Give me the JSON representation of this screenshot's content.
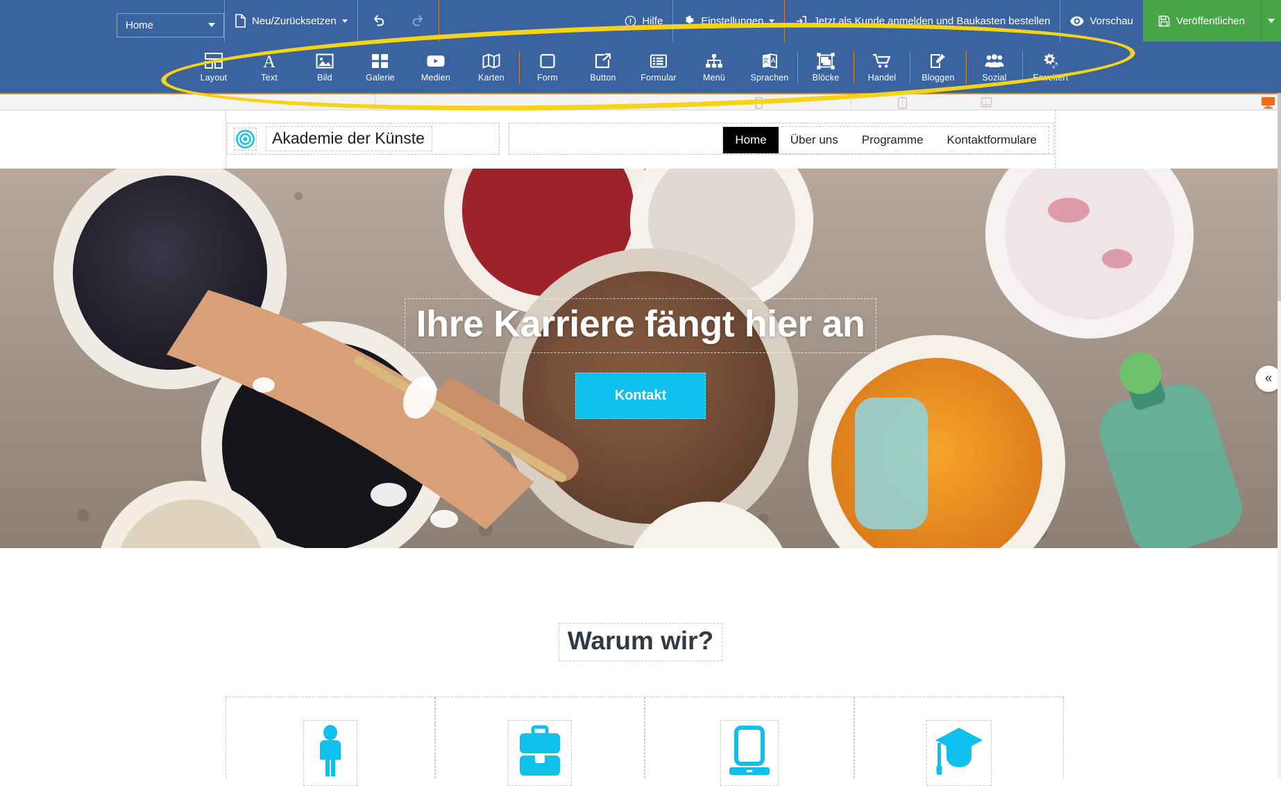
{
  "topbar": {
    "page_select": {
      "value": "Home",
      "icon": "chevron-down-icon"
    },
    "new_reset": {
      "label": "Neu/Zurücksetzen",
      "icon": "page-icon"
    },
    "undo": {
      "icon": "undo-icon",
      "label": "Rückgängig"
    },
    "redo": {
      "icon": "redo-icon",
      "label": "Wiederholen"
    },
    "help": {
      "label": "Hilfe",
      "icon": "help-circle-icon"
    },
    "settings": {
      "label": "Einstellungen",
      "icon": "gear-icon"
    },
    "order": {
      "label": "Jetzt als Kunde anmelden und Baukasten bestellen",
      "icon": "login-icon"
    },
    "preview": {
      "label": "Vorschau",
      "icon": "eye-icon"
    },
    "publish": {
      "label": "Veröffentlichen",
      "icon": "save-icon"
    }
  },
  "toolbar": {
    "items": [
      {
        "label": "Layout",
        "icon": "layout-icon"
      },
      {
        "label": "Text",
        "icon": "text-icon"
      },
      {
        "label": "Bild",
        "icon": "image-icon"
      },
      {
        "label": "Galerie",
        "icon": "gallery-icon"
      },
      {
        "label": "Medien",
        "icon": "media-icon"
      },
      {
        "label": "Karten",
        "icon": "map-icon"
      },
      {
        "label": "Form",
        "icon": "shape-icon"
      },
      {
        "label": "Button",
        "icon": "button-icon"
      },
      {
        "label": "Formular",
        "icon": "form-icon"
      },
      {
        "label": "Menü",
        "icon": "menu-tree-icon"
      },
      {
        "label": "Sprachen",
        "icon": "languages-icon"
      },
      {
        "label": "Blöcke",
        "icon": "blocks-icon"
      },
      {
        "label": "Handel",
        "icon": "cart-icon"
      },
      {
        "label": "Bloggen",
        "icon": "blog-icon"
      },
      {
        "label": "Sozial",
        "icon": "social-icon"
      },
      {
        "label": "Erweitert",
        "icon": "advanced-gears-icon"
      }
    ]
  },
  "devicebar": {
    "devices": [
      {
        "name": "phone-icon",
        "active": false
      },
      {
        "name": "tablet-icon",
        "active": false
      },
      {
        "name": "laptop-icon",
        "active": false
      },
      {
        "name": "desktop-icon",
        "active": true
      }
    ]
  },
  "site": {
    "logo": {
      "text": "Akademie der Künste",
      "icon": "target-circles-icon"
    },
    "nav": [
      {
        "label": "Home",
        "active": true
      },
      {
        "label": "Über uns",
        "active": false
      },
      {
        "label": "Programme",
        "active": false
      },
      {
        "label": "Kontaktformulare",
        "active": false
      }
    ],
    "hero": {
      "title": "Ihre Karriere fängt hier an",
      "button": "Kontakt"
    },
    "why": {
      "title": "Warum wir?",
      "features": [
        {
          "icon": "person-icon"
        },
        {
          "icon": "briefcase-icon"
        },
        {
          "icon": "tablet-device-icon"
        },
        {
          "icon": "graduation-cap-icon"
        }
      ]
    }
  },
  "panel": {
    "collapse": "«"
  },
  "colors": {
    "topbar_blue": "#3a639f",
    "divider_orange": "#e08a21",
    "publish_green": "#47a447",
    "accent_cyan": "#0fc0ec",
    "highlight_yellow": "#f5d317",
    "heading_dark": "#2f3a45"
  }
}
